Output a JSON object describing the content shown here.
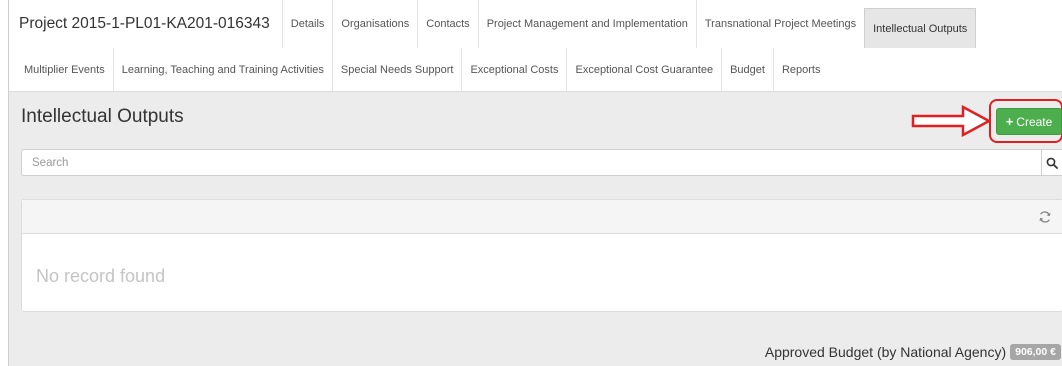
{
  "project": {
    "title": "Project 2015-1-PL01-KA201-016343"
  },
  "nav": {
    "row1": [
      "Details",
      "Organisations",
      "Contacts",
      "Project Management and Implementation",
      "Transnational Project Meetings",
      "Intellectual Outputs"
    ],
    "row2": [
      "Multiplier Events",
      "Learning, Teaching and Training Activities",
      "Special Needs Support",
      "Exceptional Costs",
      "Exceptional Cost Guarantee",
      "Budget",
      "Reports"
    ],
    "active": "Intellectual Outputs"
  },
  "page": {
    "title": "Intellectual Outputs"
  },
  "toolbar": {
    "create_label": "Create"
  },
  "search": {
    "placeholder": "Search"
  },
  "panel": {
    "empty_text": "No record found"
  },
  "footer": {
    "budget_label": "Approved Budget (by National Agency)",
    "budget_value": "906,00 €"
  },
  "colors": {
    "accent": "#4cae4c",
    "highlight": "#e02020",
    "badge": "#a6a6a6"
  },
  "icons": {
    "search": "search-icon",
    "refresh": "refresh-icon",
    "plus": "plus-icon",
    "arrow": "arrow-annotation-icon"
  }
}
